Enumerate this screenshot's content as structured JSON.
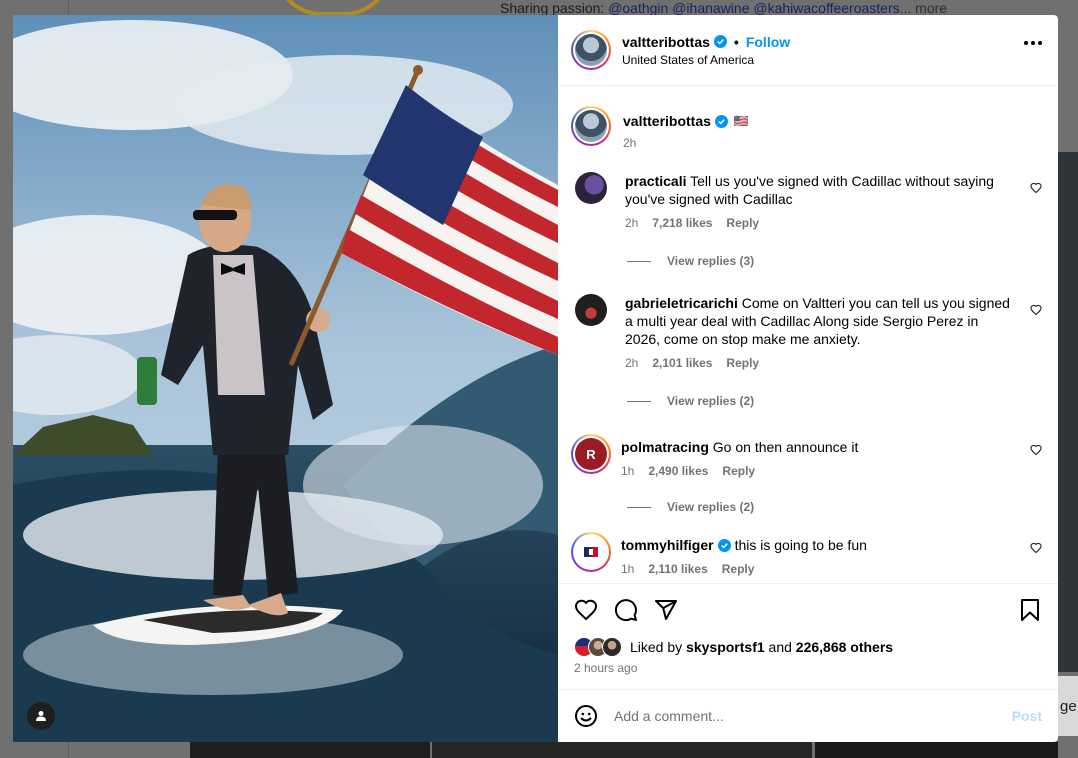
{
  "background": {
    "bio_prefix": "Sharing passion:",
    "bio_mentions": "@oathgin @ihanawine @kahiwacoffeeroasters",
    "bio_more": "... more",
    "right_fragment": "ge"
  },
  "post": {
    "header": {
      "username": "valtteribottas",
      "separator": "•",
      "follow_label": "Follow",
      "location": "United States of America"
    },
    "caption": {
      "username": "valtteribottas",
      "flag": "🇺🇸",
      "time": "2h"
    },
    "comments": [
      {
        "username": "practicali",
        "text": "Tell us you've signed with Cadillac without saying you've signed with Cadillac",
        "time": "2h",
        "likes": "7,218 likes",
        "reply_label": "Reply",
        "view_replies": "View replies (3)"
      },
      {
        "username": "gabrieletricarichi",
        "text": "Come on Valtteri you can tell us you signed a multi year deal with Cadillac Along side Sergio Perez in 2026, come on stop make me anxiety.",
        "time": "2h",
        "likes": "2,101 likes",
        "reply_label": "Reply",
        "view_replies": "View replies (2)"
      },
      {
        "username": "polmatracing",
        "text": "Go on then announce it",
        "time": "1h",
        "likes": "2,490 likes",
        "reply_label": "Reply",
        "view_replies": "View replies (2)"
      },
      {
        "username": "tommyhilfiger",
        "text": "this is going to be fun",
        "time": "1h",
        "likes": "2,110 likes",
        "reply_label": "Reply",
        "view_replies": ""
      }
    ],
    "likes_summary": {
      "prefix": "Liked by",
      "liker": "skysportsf1",
      "middle": "and",
      "others": "226,868 others"
    },
    "posted_ago": "2 hours ago",
    "add_comment": {
      "placeholder": "Add a comment...",
      "post_label": "Post"
    },
    "icons": {
      "like": "heart-icon",
      "comment": "comment-bubble-icon",
      "share": "paper-plane-icon",
      "save": "bookmark-icon",
      "emoji": "smiley-icon",
      "more": "more-horizontal-icon",
      "user_tag": "user-tag-icon",
      "verified": "verified-badge-icon"
    },
    "colors": {
      "follow": "#0095f6",
      "verified": "#0095f6",
      "muted": "#737373",
      "post_disabled": "#b2dffc"
    }
  }
}
